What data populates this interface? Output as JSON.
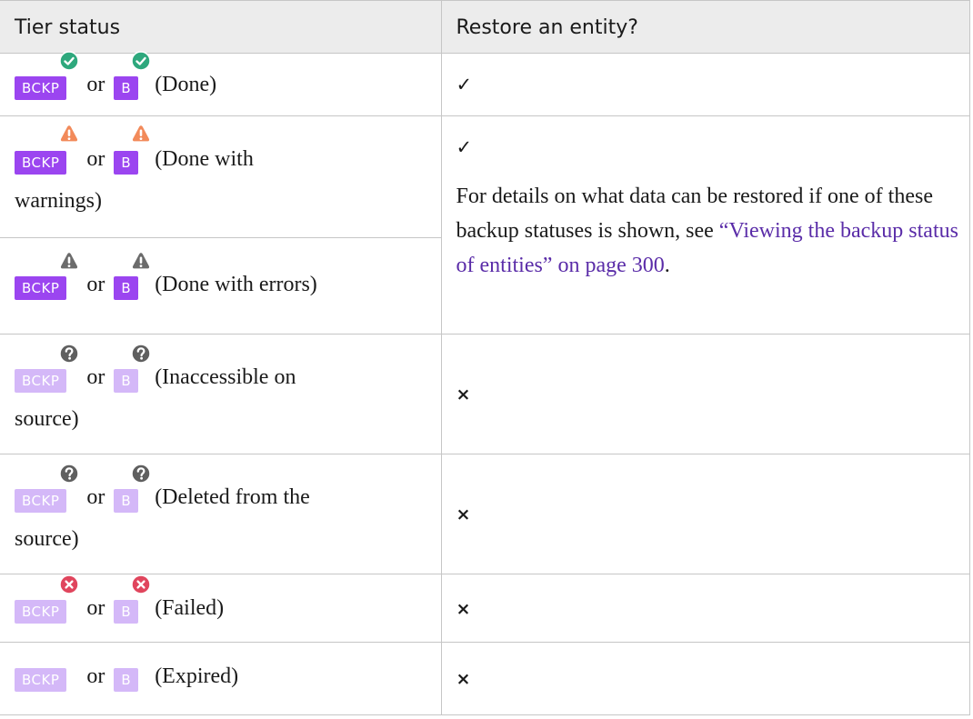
{
  "header": {
    "col1": "Tier status",
    "col2": "Restore an entity?"
  },
  "colors": {
    "badge": "#9b45f0",
    "badge_faded": "#d4b8f8",
    "ok": "#2ea87d",
    "warning": "#f28a5a",
    "error": "#6b6b6b",
    "unknown": "#5f5f5f",
    "failed": "#e0455d",
    "link": "#5a2ca8"
  },
  "badge_labels": {
    "long": "BCKP",
    "short": "B"
  },
  "or_text": "or",
  "rows": [
    {
      "status": "(Done)",
      "icon": "check-circle-icon",
      "restore": "✓"
    },
    {
      "status": "(Done with",
      "status2": "warnings)",
      "icon": "warning-icon",
      "restore": "✓"
    },
    {
      "status": "(Done with errors)",
      "icon": "warning-icon"
    },
    {
      "status": "(Inaccessible on",
      "status2": "source)",
      "icon": "question-icon",
      "restore": "×"
    },
    {
      "status": "(Deleted from the",
      "status2": "source)",
      "icon": "question-icon",
      "restore": "×"
    },
    {
      "status": "(Failed)",
      "icon": "x-circle-icon",
      "restore": "×"
    },
    {
      "status": "(Expired)",
      "icon": "",
      "restore": "×"
    }
  ],
  "note": {
    "text": "For details on what data can be restored if one of these backup statuses is shown, see",
    "link": "“Viewing the backup status of entities” on page 300",
    "after": "."
  }
}
